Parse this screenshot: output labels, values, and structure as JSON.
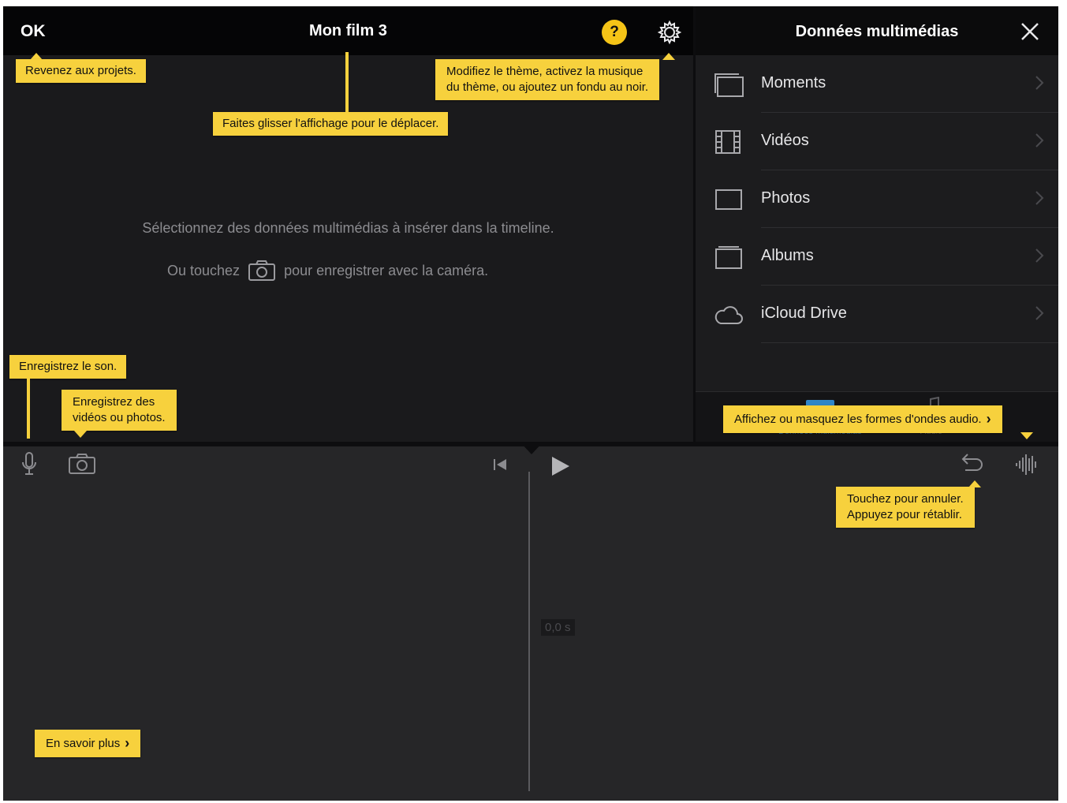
{
  "app": {
    "done_label": "OK",
    "project_title": "Mon film 3",
    "help_label": "?"
  },
  "viewer": {
    "empty_message": "Sélectionnez des données multimédias à insérer dans la timeline.",
    "camera_hint_prefix": "Ou touchez",
    "camera_hint_suffix": "pour enregistrer avec la caméra."
  },
  "media_panel": {
    "title": "Données multimédias",
    "items": [
      {
        "label": "Moments",
        "icon": "moments-icon"
      },
      {
        "label": "Vidéos",
        "icon": "film-icon"
      },
      {
        "label": "Photos",
        "icon": "photo-icon"
      },
      {
        "label": "Albums",
        "icon": "album-icon"
      },
      {
        "label": "iCloud Drive",
        "icon": "cloud-icon"
      }
    ],
    "tabs": [
      {
        "label": "Données multimédias",
        "icon": "media-tab-icon"
      },
      {
        "label": "Audio",
        "icon": "audio-tab-icon"
      }
    ]
  },
  "timeline": {
    "timecode": "0,0 s"
  },
  "tooltips": {
    "back_projects": "Revenez aux projets.",
    "drag_view": "Faites glisser l'affichage pour le déplacer.",
    "theme_line1": "Modifiez le thème, activez la musique",
    "theme_line2": "du thème, ou ajoutez un fondu au noir.",
    "record_sound": "Enregistrez le son.",
    "record_video_line1": "Enregistrez des",
    "record_video_line2": "vidéos ou photos.",
    "waveforms": "Affichez ou masquez les formes d'ondes audio.",
    "undo_line1": "Touchez pour annuler.",
    "undo_line2": "Appuyez pour rétablir.",
    "learn_more": "En savoir plus"
  },
  "colors": {
    "tooltip_bg": "#f7d13d",
    "help_button": "#f5c417",
    "accent_blue": "#2f86c9"
  }
}
